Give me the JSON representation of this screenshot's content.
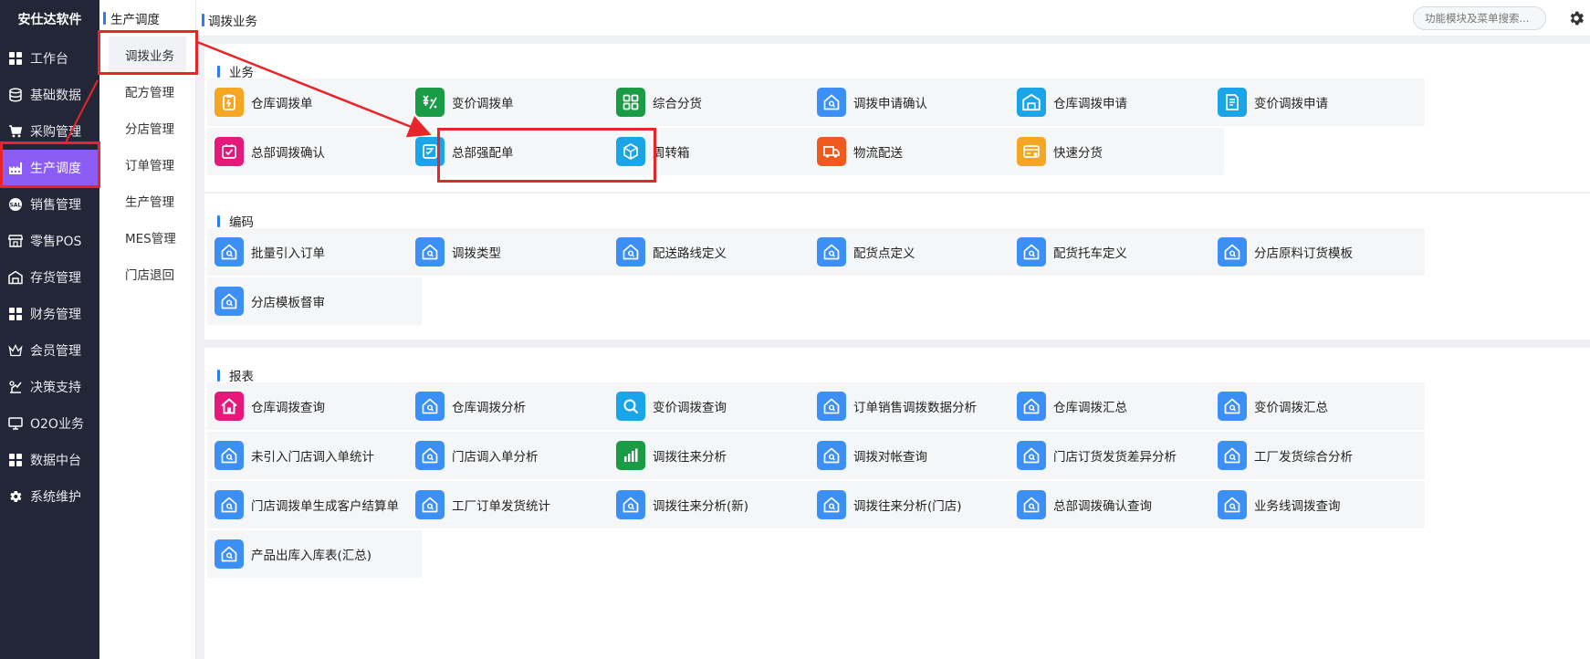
{
  "brand": "安仕达软件",
  "nav": [
    {
      "label": "工作台",
      "icon": "grid-icon"
    },
    {
      "label": "基础数据",
      "icon": "database-icon"
    },
    {
      "label": "采购管理",
      "icon": "cart-icon"
    },
    {
      "label": "生产调度",
      "icon": "factory-icon"
    },
    {
      "label": "销售管理",
      "icon": "sales-badge-icon"
    },
    {
      "label": "零售POS",
      "icon": "store-icon"
    },
    {
      "label": "存货管理",
      "icon": "warehouse-icon"
    },
    {
      "label": "财务管理",
      "icon": "grid-icon"
    },
    {
      "label": "会员管理",
      "icon": "crown-icon"
    },
    {
      "label": "决策支持",
      "icon": "decision-icon"
    },
    {
      "label": "O2O业务",
      "icon": "monitor-icon"
    },
    {
      "label": "数据中台",
      "icon": "grid-icon"
    },
    {
      "label": "系统维护",
      "icon": "gear-icon"
    }
  ],
  "active_nav": "生产调度",
  "subnav": {
    "header": "生产调度",
    "items": [
      "调拨业务",
      "配方管理",
      "分店管理",
      "订单管理",
      "生产管理",
      "MES管理",
      "门店退回"
    ]
  },
  "topbar": {
    "breadcrumb": "调拨业务",
    "search_placeholder": "功能模块及菜单搜索..."
  },
  "sections": [
    {
      "title": "业务",
      "tiles": [
        {
          "label": "仓库调拨单",
          "icon": "clipboard-icon",
          "color": "#f5a623"
        },
        {
          "label": "变价调拨单",
          "icon": "price-change-icon",
          "color": "#1a9b45"
        },
        {
          "label": "综合分货",
          "icon": "apps-icon",
          "color": "#1a9b45"
        },
        {
          "label": "调拨申请确认",
          "icon": "house-icon",
          "color": "#3b8ff5"
        },
        {
          "label": "仓库调拨申请",
          "icon": "warehouse-icon",
          "color": "#1aa5e8"
        },
        {
          "label": "变价调拨申请",
          "icon": "document-icon",
          "color": "#1aa5e8"
        },
        {
          "label": "总部调拨确认",
          "icon": "check-box-icon",
          "color": "#e6197a"
        },
        {
          "label": "总部强配单",
          "icon": "checklist-icon",
          "color": "#1aa5e8"
        },
        {
          "label": "周转箱",
          "icon": "box-icon",
          "color": "#1aa5e8"
        },
        {
          "label": "物流配送",
          "icon": "truck-icon",
          "color": "#f05a1e"
        },
        {
          "label": "快速分货",
          "icon": "card-icon",
          "color": "#f5a623"
        }
      ]
    },
    {
      "title": "编码",
      "tiles": [
        {
          "label": "批量引入订单",
          "icon": "house-icon",
          "color": "#3b8ff5"
        },
        {
          "label": "调拨类型",
          "icon": "house-icon",
          "color": "#3b8ff5"
        },
        {
          "label": "配送路线定义",
          "icon": "house-icon",
          "color": "#3b8ff5"
        },
        {
          "label": "配货点定义",
          "icon": "house-icon",
          "color": "#3b8ff5"
        },
        {
          "label": "配货托车定义",
          "icon": "house-icon",
          "color": "#3b8ff5"
        },
        {
          "label": "分店原料订货模板",
          "icon": "house-icon",
          "color": "#3b8ff5"
        },
        {
          "label": "分店模板督审",
          "icon": "house-icon",
          "color": "#3b8ff5"
        }
      ]
    },
    {
      "title": "报表",
      "tiles": [
        {
          "label": "仓库调拨查询",
          "icon": "home-icon",
          "color": "#e6197a"
        },
        {
          "label": "仓库调拨分析",
          "icon": "house-icon",
          "color": "#3b8ff5"
        },
        {
          "label": "变价调拨查询",
          "icon": "magnifier-icon",
          "color": "#1aa5e8"
        },
        {
          "label": "订单销售调拨数据分析",
          "icon": "house-icon",
          "color": "#3b8ff5"
        },
        {
          "label": "仓库调拨汇总",
          "icon": "house-icon",
          "color": "#3b8ff5"
        },
        {
          "label": "变价调拨汇总",
          "icon": "house-icon",
          "color": "#3b8ff5"
        },
        {
          "label": "未引入门店调入单统计",
          "icon": "house-icon",
          "color": "#3b8ff5"
        },
        {
          "label": "门店调入单分析",
          "icon": "house-icon",
          "color": "#3b8ff5"
        },
        {
          "label": "调拨往来分析",
          "icon": "bar-chart-icon",
          "color": "#1a9b45"
        },
        {
          "label": "调拨对帐查询",
          "icon": "house-icon",
          "color": "#3b8ff5"
        },
        {
          "label": "门店订货发货差异分析",
          "icon": "house-icon",
          "color": "#3b8ff5"
        },
        {
          "label": "工厂发货综合分析",
          "icon": "house-icon",
          "color": "#3b8ff5"
        },
        {
          "label": "门店调拨单生成客户结算单",
          "icon": "house-icon",
          "color": "#3b8ff5"
        },
        {
          "label": "工厂订单发货统计",
          "icon": "house-icon",
          "color": "#3b8ff5"
        },
        {
          "label": "调拨往来分析(新)",
          "icon": "house-icon",
          "color": "#3b8ff5"
        },
        {
          "label": "调拨往来分析(门店)",
          "icon": "house-icon",
          "color": "#3b8ff5"
        },
        {
          "label": "总部调拨确认查询",
          "icon": "house-icon",
          "color": "#3b8ff5"
        },
        {
          "label": "业务线调拨查询",
          "icon": "house-icon",
          "color": "#3b8ff5"
        },
        {
          "label": "产品出库入库表(汇总)",
          "icon": "house-icon",
          "color": "#3b8ff5"
        }
      ]
    }
  ],
  "colors": {
    "sidebar_bg": "#232636",
    "active_nav": "#8b5cf6",
    "accent": "#2f7bf6",
    "annotation_red": "#e8262a"
  }
}
